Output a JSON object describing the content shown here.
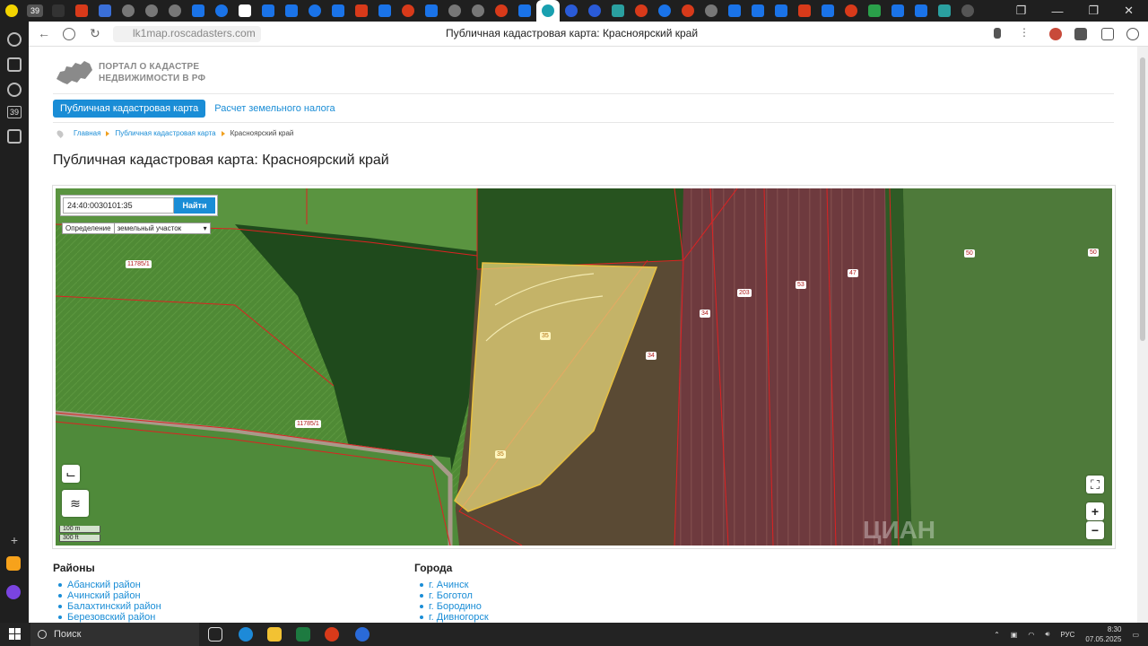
{
  "browser": {
    "tab_badge": "39",
    "url": "lk1map.roscadasters.com",
    "page_title": "Публичная кадастровая карта: Красноярский край"
  },
  "site": {
    "logo_line1": "ПОРТАЛ О КАДАСТРЕ",
    "logo_line2": "НЕДВИЖИМОСТИ В РФ",
    "nav": {
      "active": "Публичная кадастровая карта",
      "link": "Расчет земельного налога"
    },
    "breadcrumbs": [
      "Главная",
      "Публичная кадастровая карта",
      "Красноярский край"
    ],
    "heading": "Публичная кадастровая карта: Красноярский край"
  },
  "map": {
    "search_value": "24:40:0030101:35",
    "search_button": "Найти",
    "definition_label": "Определение",
    "definition_value": "земельный участок",
    "labels": {
      "l1": "11785/1",
      "l2": "11785/1",
      "l3": "35",
      "l4": "35",
      "l5": "34",
      "l6": "34",
      "l7": "203",
      "l8": "53",
      "l9": "47",
      "l10": "50",
      "l11": "50"
    },
    "scale_m": "100 m",
    "scale_ft": "300 ft",
    "zoom_in": "+",
    "zoom_out": "−",
    "watermark": "ЦИАН"
  },
  "districts": {
    "title": "Районы",
    "items": [
      "Абанский район",
      "Ачинский район",
      "Балахтинский район",
      "Березовский район"
    ]
  },
  "cities": {
    "title": "Города",
    "items": [
      "г. Ачинск",
      "г. Боготол",
      "г. Бородино",
      "г. Дивногорск"
    ]
  },
  "taskbar": {
    "search": "Поиск",
    "lang": "РУС",
    "time": "8:30",
    "date": "07.05.2025"
  },
  "colors": {
    "accent": "#1a8dd6",
    "parcel_fill": "#e8d77a",
    "parcel_border": "#c81e1e"
  }
}
